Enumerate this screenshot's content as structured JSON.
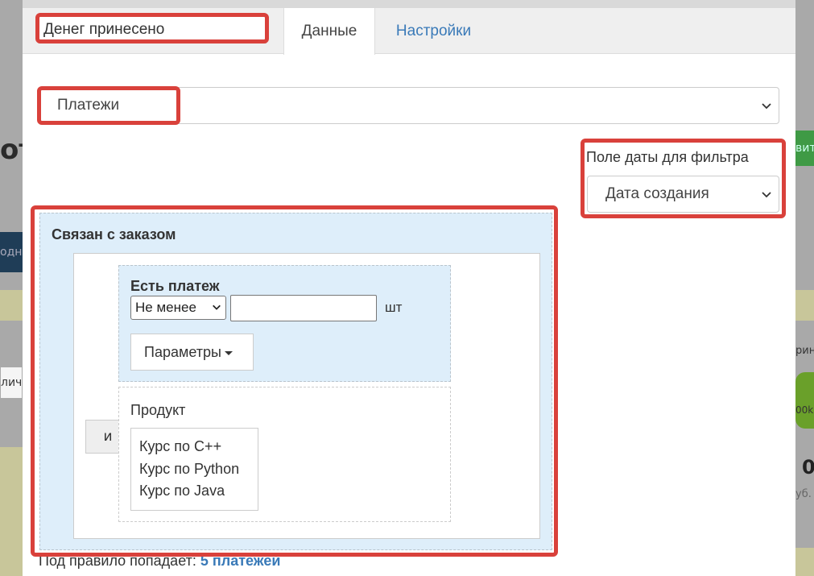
{
  "background": {
    "heading_fragment": "от",
    "dark_chip_text": "одн",
    "left_chip_text": "лич",
    "green_button_text": "вить",
    "right_text_1": "рин",
    "right_text_2": "00k",
    "right_big_value": "0",
    "right_text_3": "уб."
  },
  "modal": {
    "title_value": "Денег принесено",
    "tabs": [
      {
        "label": "Данные",
        "active": true
      },
      {
        "label": "Настройки",
        "active": false
      }
    ],
    "source_select": {
      "value": "Платежи"
    },
    "date_filter": {
      "label": "Поле даты для фильтра",
      "value": "Дата создания"
    },
    "condition": {
      "title": "Связан с заказом",
      "operator_label": "и",
      "payment": {
        "title": "Есть платеж",
        "comparator": "Не менее",
        "quantity": "",
        "unit": "шт",
        "params_label": "Параметры"
      },
      "product": {
        "label": "Продукт",
        "options": [
          "Курс по C++",
          "Курс по Python",
          "Курс по Java"
        ]
      }
    },
    "footer": {
      "prefix": "Под правило попадает:",
      "count_link": "5 платежей"
    }
  },
  "colors": {
    "highlight": "#d9413b",
    "link": "#3a7ab8",
    "condition_bg": "#deeefa"
  }
}
